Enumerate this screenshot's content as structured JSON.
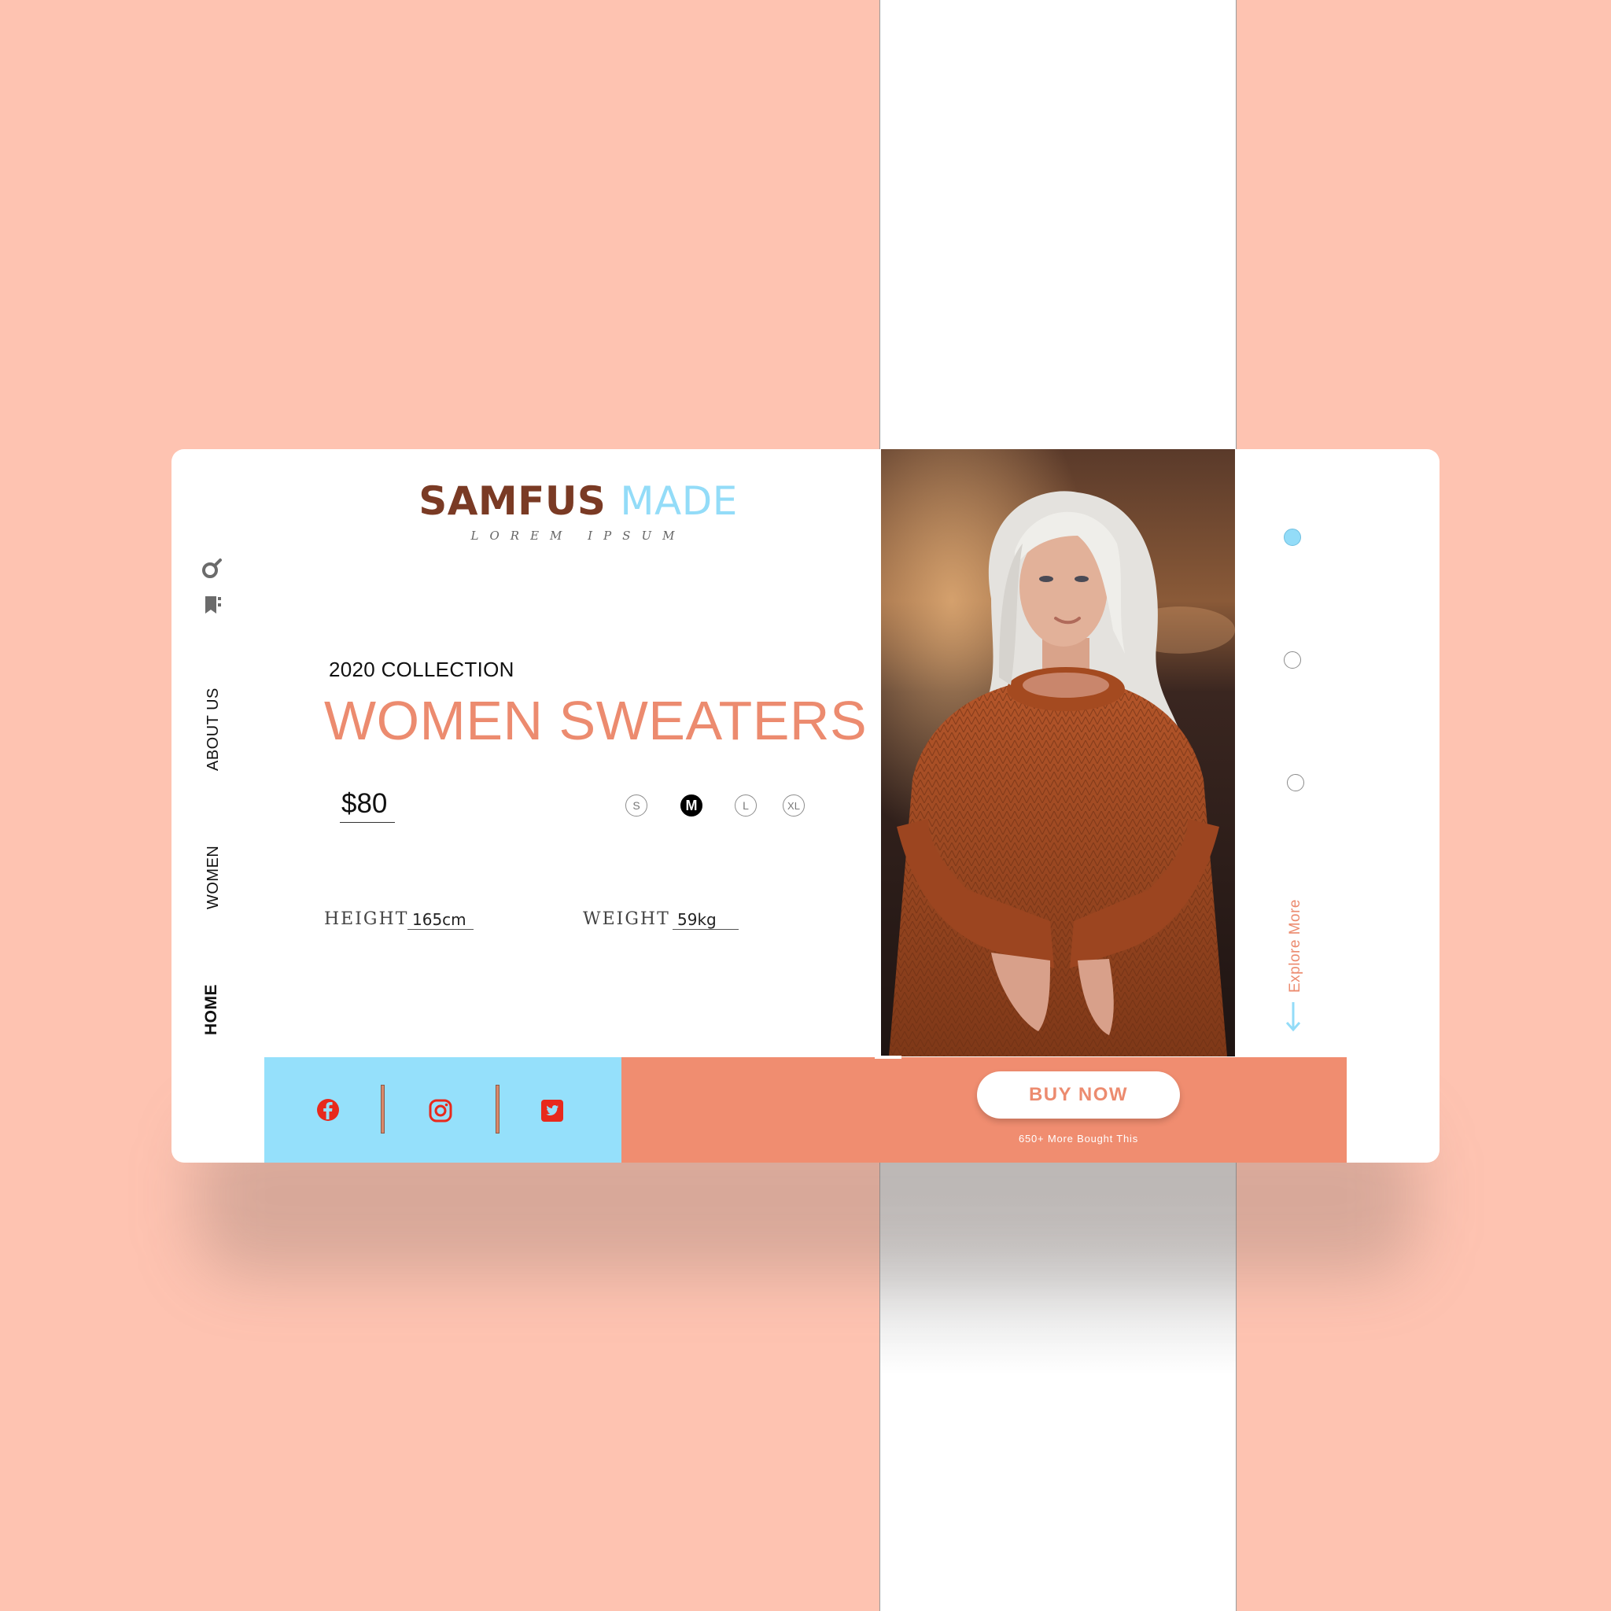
{
  "brand": {
    "name_part1": "SAMFUS",
    "name_part2": "MADE",
    "tagline": "LOREM IPSUM",
    "color_dark": "#7a3a24",
    "color_light": "#93dcf8"
  },
  "nav": {
    "items": [
      {
        "label": "ABOUT US"
      },
      {
        "label": "WOMEN"
      },
      {
        "label": "HOME",
        "active": true
      }
    ]
  },
  "icons": [
    "search-icon",
    "shopping-bag-icon",
    "facebook-icon",
    "instagram-icon",
    "twitter-icon",
    "arrow-down-icon"
  ],
  "product": {
    "collection": "2020 COLLECTION",
    "title": "WOMEN SWEATERS",
    "price": "$80",
    "sizes": [
      {
        "label": "S"
      },
      {
        "label": "M",
        "selected": true
      },
      {
        "label": "L"
      },
      {
        "label": "XL"
      }
    ],
    "height_label": "HEIGHT",
    "height_value": "165cm",
    "weight_label": "WEIGHT",
    "weight_value": "59kg"
  },
  "slider": {
    "count": 3,
    "active_index": 0
  },
  "explore_label": "Explore More",
  "cta": {
    "button_label": "BUY NOW",
    "subtext": "650+ More Bought This"
  },
  "colors": {
    "background": "#fec3b1",
    "accent": "#ec8b6f",
    "social_bar": "#95e0fb",
    "buy_bar": "#f08d70",
    "social_icons": "#e8291c"
  }
}
